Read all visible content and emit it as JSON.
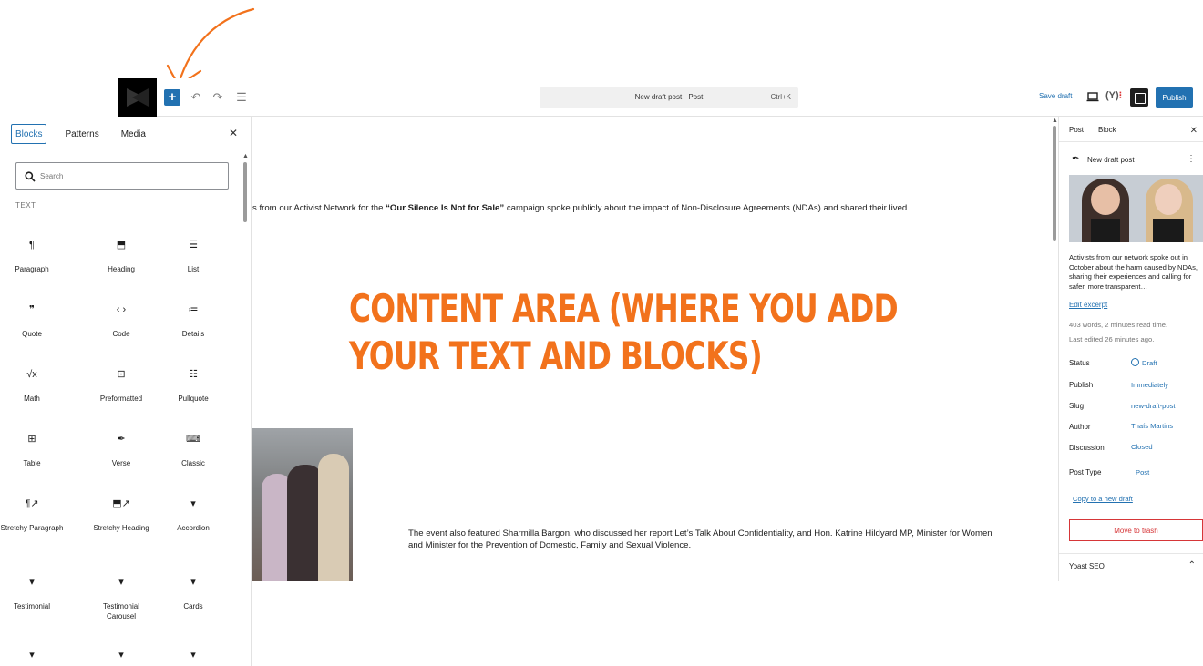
{
  "toolbar": {
    "inserter_icon": "+",
    "undo_icon": "↶",
    "redo_icon": "↷",
    "outline_icon": "☰",
    "command_title": "New draft post · Post",
    "command_shortcut": "Ctrl+K",
    "save_draft": "Save draft",
    "yoast": "(Y)",
    "yoast_dot": "⁝",
    "publish": "Publish"
  },
  "inserter": {
    "tabs": [
      "Blocks",
      "Patterns",
      "Media"
    ],
    "close_icon": "✕",
    "search_placeholder": "Search",
    "category": "TEXT",
    "scroll_up": "▲",
    "blocks": [
      {
        "label": "Paragraph",
        "icon": "¶"
      },
      {
        "label": "Heading",
        "icon": "⬒"
      },
      {
        "label": "List",
        "icon": "☰"
      },
      {
        "label": "Quote",
        "icon": "❞"
      },
      {
        "label": "Code",
        "icon": "‹ ›"
      },
      {
        "label": "Details",
        "icon": "≔"
      },
      {
        "label": "Math",
        "icon": "√x"
      },
      {
        "label": "Preformatted",
        "icon": "⊡"
      },
      {
        "label": "Pullquote",
        "icon": "☷"
      },
      {
        "label": "Table",
        "icon": "⊞"
      },
      {
        "label": "Verse",
        "icon": "✒"
      },
      {
        "label": "Classic",
        "icon": "⌨"
      },
      {
        "label": "Stretchy Paragraph",
        "icon": "¶↗"
      },
      {
        "label": "Stretchy Heading",
        "icon": "⬒↗"
      },
      {
        "label": "Accordion",
        "icon": "▾"
      },
      {
        "label": "Testimonial",
        "icon": "▾"
      },
      {
        "label": "Testimonial Carousel",
        "icon": "▾"
      },
      {
        "label": "Cards",
        "icon": "▾"
      },
      {
        "label": "",
        "icon": "▾"
      },
      {
        "label": "",
        "icon": "▾"
      },
      {
        "label": "",
        "icon": "▾"
      }
    ]
  },
  "canvas": {
    "para1_start": "s from our Activist Network for the ",
    "para1_bold": "“Our Silence Is Not for Sale”",
    "para1_end": " campaign spoke publicly about the impact of Non-Disclosure Agreements (NDAs) and shared their lived",
    "para2": "The event also featured Sharmilla Bargon, who discussed her report Let’s Talk About Confidentiality, and Hon. Katrine Hildyard MP, Minister for Women and Minister for the Prevention of Domestic, Family and Sexual Violence.",
    "scroll_up": "▲"
  },
  "annotation": {
    "line1": "CONTENT AREA (WHERE YOU ADD",
    "line2": "YOUR TEXT AND BLOCKS)",
    "color": "#f2721c"
  },
  "sidebar": {
    "tabs": [
      "Post",
      "Block"
    ],
    "close_icon": "✕",
    "post_title": "New draft post",
    "post_icon": "✒",
    "more_icon": "⋮",
    "excerpt": "Activists from our network spoke out in October about the harm caused by NDAs, sharing their experiences and calling for safer, more transparent…",
    "edit_excerpt": "Edit excerpt",
    "words": "403 words, 2 minutes read time.",
    "last_edited": "Last edited 26 minutes ago.",
    "rows": [
      {
        "label": "Status",
        "value": "Draft"
      },
      {
        "label": "Publish",
        "value": "Immediately"
      },
      {
        "label": "Slug",
        "value": "new-draft-post"
      },
      {
        "label": "Author",
        "value": "Thaís Martins"
      },
      {
        "label": "Discussion",
        "value": "Closed"
      },
      {
        "label": "Post Type",
        "value": "Post"
      }
    ],
    "copy_draft": "Copy to a new draft",
    "trash": "Move to trash",
    "yoast_section": "Yoast SEO",
    "yoast_chevron": "⌃"
  },
  "colors": {
    "accent": "#2271b1",
    "danger": "#d63638",
    "annotation": "#f2721c"
  }
}
